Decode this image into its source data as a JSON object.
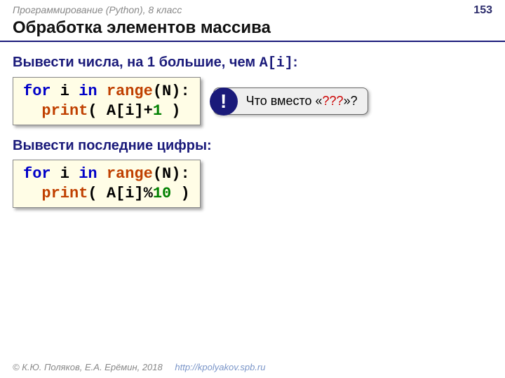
{
  "header": {
    "course": "Программирование (Python), 8 класс",
    "page": "153"
  },
  "title": "Обработка элементов массива",
  "section1": {
    "prompt_pre": "Вывести числа, на 1 большие, чем ",
    "prompt_code": "A[i]",
    "prompt_post": ":",
    "code": {
      "kw_for": "for",
      "var_i": " i ",
      "kw_in": "in",
      "sp1": " ",
      "fn_range": "range",
      "paren_n": "(N):",
      "indent": "  ",
      "fn_print": "print",
      "args_pre": "( A[i]+",
      "num_1": "1",
      "args_post": " )"
    }
  },
  "callout": {
    "badge": "!",
    "text_pre": "Что вместо «",
    "qmarks": "???",
    "text_post": "»?"
  },
  "section2": {
    "prompt": "Вывести последние цифры:",
    "code": {
      "kw_for": "for",
      "var_i": " i ",
      "kw_in": "in",
      "sp1": " ",
      "fn_range": "range",
      "paren_n": "(N):",
      "indent": "  ",
      "fn_print": "print",
      "args_pre": "( A[i]%",
      "num_10": "10",
      "args_post": " )"
    }
  },
  "footer": {
    "copyright": "© К.Ю. Поляков, Е.А. Ерёмин, 2018",
    "url": "http://kpolyakov.spb.ru"
  }
}
